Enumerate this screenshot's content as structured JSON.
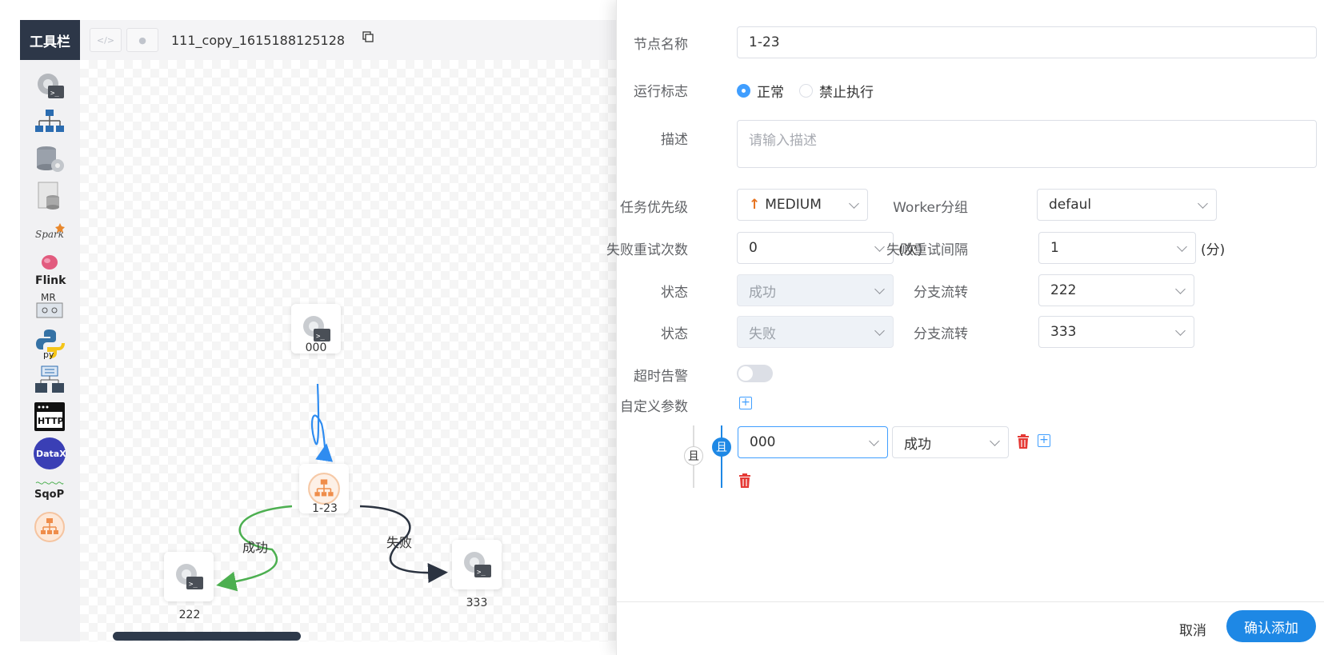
{
  "toolbar": {
    "title": "工具栏",
    "tools": [
      {
        "name": "shell-tool",
        "label": ""
      },
      {
        "name": "sub-process-tool",
        "label": ""
      },
      {
        "name": "procedure-tool",
        "label": ""
      },
      {
        "name": "sql-tool",
        "label": ""
      },
      {
        "name": "spark-tool",
        "label": "Spark"
      },
      {
        "name": "flink-tool",
        "label": "Flink"
      },
      {
        "name": "mr-tool",
        "label": "MR"
      },
      {
        "name": "python-tool",
        "label": "py"
      },
      {
        "name": "dependent-tool",
        "label": ""
      },
      {
        "name": "http-tool",
        "label": "HTTP"
      },
      {
        "name": "datax-tool",
        "label": "DataX"
      },
      {
        "name": "sqoop-tool",
        "label": "SqoP"
      },
      {
        "name": "conditions-tool",
        "label": ""
      }
    ]
  },
  "header": {
    "workflow_name": "111_copy_1615188125128"
  },
  "dag": {
    "nodes": [
      {
        "id": "000",
        "type": "shell"
      },
      {
        "id": "1-23",
        "type": "conditions"
      },
      {
        "id": "222",
        "type": "shell"
      },
      {
        "id": "333",
        "type": "shell"
      }
    ],
    "edges": [
      {
        "from": "000",
        "to": "1-23",
        "label": ""
      },
      {
        "from": "1-23",
        "to": "222",
        "label": "成功"
      },
      {
        "from": "1-23",
        "to": "333",
        "label": "失败"
      }
    ],
    "colors": {
      "default_edge": "#2f8cf0",
      "success_edge": "#4caf50",
      "fail_edge": "#2b3340"
    }
  },
  "form": {
    "node_name": {
      "label": "节点名称",
      "value": "1-23"
    },
    "run_flag": {
      "label": "运行标志",
      "options": [
        "正常",
        "禁止执行"
      ],
      "selected": "正常"
    },
    "description": {
      "label": "描述",
      "placeholder": "请输入描述"
    },
    "priority": {
      "label": "任务优先级",
      "value": "MEDIUM",
      "arrow": "↑"
    },
    "worker_group": {
      "label": "Worker分组",
      "value": "defaul"
    },
    "retry_times": {
      "label": "失败重试次数",
      "value": "0",
      "unit": "(次)"
    },
    "retry_interval": {
      "label": "失败重试间隔",
      "value": "1",
      "unit": "(分)"
    },
    "branches": [
      {
        "state_label": "状态",
        "state": "成功",
        "flow_label": "分支流转",
        "flow": "222"
      },
      {
        "state_label": "状态",
        "state": "失败",
        "flow_label": "分支流转",
        "flow": "333"
      }
    ],
    "timeout_alarm": {
      "label": "超时告警",
      "enabled": false
    },
    "custom_params": {
      "label": "自定义参数",
      "outer_relation": "且",
      "inner_relation": "且",
      "condition": {
        "task": "000",
        "status": "成功"
      }
    }
  },
  "footer": {
    "cancel": "取消",
    "confirm": "确认添加"
  },
  "colors": {
    "accent": "#1e88e5",
    "danger": "#e53935",
    "priority_arrow": "#e6731f"
  }
}
